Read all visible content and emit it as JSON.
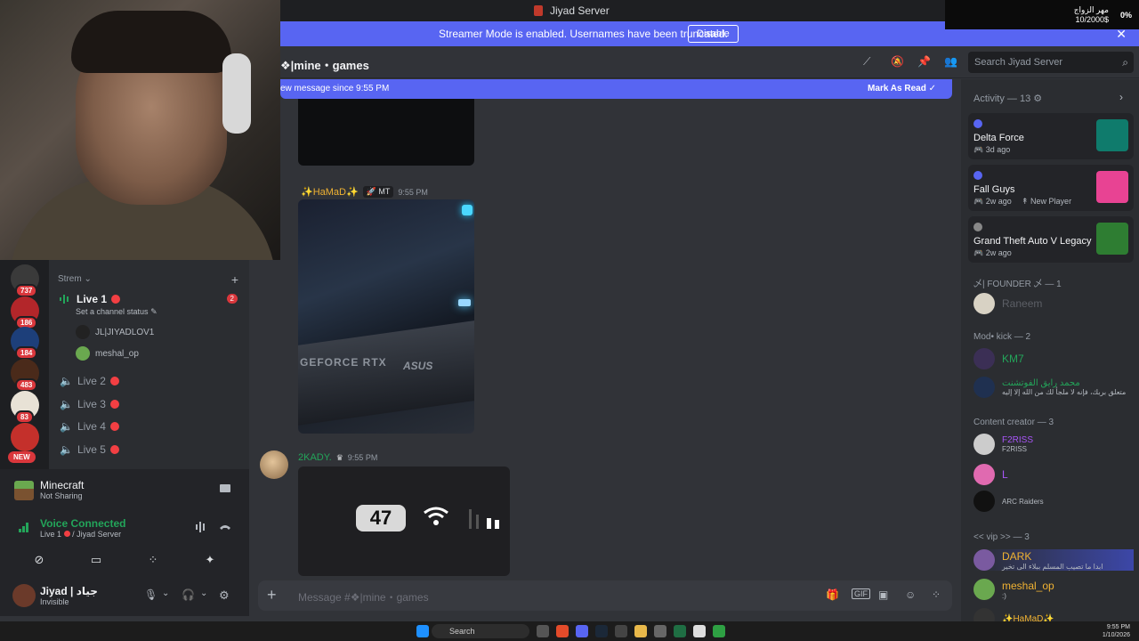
{
  "window": {
    "title": "Jiyad Server"
  },
  "streamer_banner": {
    "message": "Streamer Mode is enabled. Usernames have been truncated.",
    "disable_label": "Disable"
  },
  "overlay": {
    "line1": "مهر الزواج",
    "line2": "10/2000$",
    "percent": "0%"
  },
  "servers": [
    {
      "badge": "737",
      "color": "#3a3a3a"
    },
    {
      "badge": "186",
      "color": "#b3262a"
    },
    {
      "badge": "184",
      "color": "#1d3f7a"
    },
    {
      "badge": "483",
      "color": "#4a2a1a"
    },
    {
      "badge": "83",
      "color": "#e8e2d6"
    },
    {
      "badge": "",
      "color": "#c4302b"
    }
  ],
  "new_badge": "NEW",
  "sidebar": {
    "category": "Strem",
    "live1": {
      "name": "Live 1",
      "status": "Set a channel status",
      "ping": "2"
    },
    "voice_users": [
      "JL|JIYADLOV1",
      "meshal_op"
    ],
    "channels": [
      "Live 2",
      "Live 3",
      "Live 4",
      "Live 5"
    ]
  },
  "activity_panel": {
    "game": "Minecraft",
    "game_status": "Not Sharing",
    "voice_title": "Voice Connected",
    "voice_channel": "Live 1",
    "voice_server": "/ Jiyad Server"
  },
  "user": {
    "name": "Jiyad | جياد",
    "status": "Invisible"
  },
  "chat": {
    "channel_name": "❖|mine・games",
    "new_message_bar": "ew message since 9:55 PM",
    "mark_read": "Mark As Read",
    "messages": [
      {
        "author": "✨HaMaD✨",
        "tag": "MT",
        "time": "9:55 PM",
        "image_text1": "GEFORCE RTX",
        "image_text2": "ASUS"
      },
      {
        "author": "2KADY.",
        "time": "9:55 PM",
        "battery": "47"
      }
    ],
    "composer_placeholder": "Message #❖|mine・games"
  },
  "search": {
    "placeholder": "Search Jiyad Server"
  },
  "right_panel": {
    "activity_title": "Activity — 13",
    "activities": [
      {
        "name": "Delta Force",
        "time": "3d ago",
        "extra": ""
      },
      {
        "name": "Fall Guys",
        "time": "2w ago",
        "extra": "New Player"
      },
      {
        "name": "Grand Theft Auto V Legacy",
        "time": "2w ago",
        "extra": ""
      }
    ],
    "roles": [
      {
        "title": "乄| FOUNDER 乄 — 1",
        "members": [
          {
            "name": "Raneem",
            "sub": "",
            "color": "#5c5f66"
          }
        ]
      },
      {
        "title": "Mod• kick — 2",
        "members": [
          {
            "name": "KM7",
            "sub": "",
            "color": "#23a55a"
          },
          {
            "name": "محمد رايق الفوتشنت",
            "sub": "متعلق بربك، فإنه لا ملجأ لك من الله إلا إليه",
            "color": "#23a55a"
          }
        ]
      },
      {
        "title": "Content creator — 3",
        "members": [
          {
            "name": "F2RISS",
            "sub": "F2RISS",
            "color": "#a855f7"
          },
          {
            "name": "L",
            "sub": "",
            "color": "#a855f7"
          },
          {
            "name": "",
            "sub": "ARC Raiders",
            "color": "#a855f7"
          }
        ]
      },
      {
        "title": "<< vip >> — 3",
        "members": [
          {
            "name": "DARK",
            "sub": "ابدا ما تصيب المسلم ببلاء الى تخير",
            "color": "#f0b232"
          },
          {
            "name": "meshal_op",
            "sub": ":)",
            "color": "#f0b232"
          },
          {
            "name": "✨HaMaD✨",
            "sub": "",
            "color": "#f0b232"
          }
        ]
      }
    ]
  },
  "taskbar": {
    "search": "Search",
    "time": "9:55 PM",
    "date": "1/10/2026"
  }
}
